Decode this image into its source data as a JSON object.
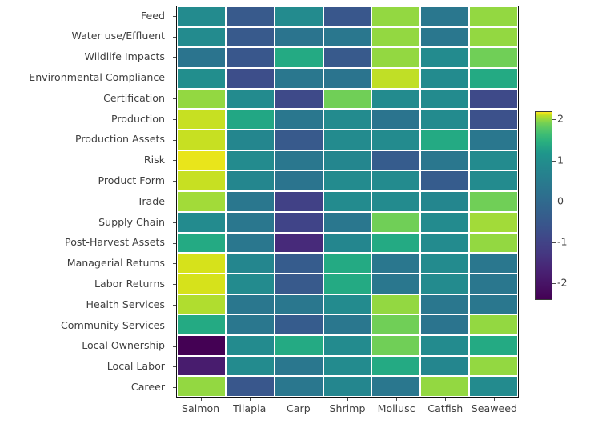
{
  "figure": {
    "type": "heatmap",
    "background": "#ffffff",
    "tick_label_color": "#3f3f3f"
  },
  "chart_data": {
    "type": "heatmap",
    "title": "",
    "xlabel": "",
    "ylabel": "",
    "colormap": "viridis",
    "grid": false,
    "legend_position": "right",
    "colorbar": {
      "vmin": -2.4,
      "vmax": 2.2,
      "ticks": [
        2,
        1,
        0,
        -1,
        -2
      ],
      "tick_labels": [
        "2",
        "1",
        "0",
        "-1",
        "-2"
      ]
    },
    "categories": [
      "Salmon",
      "Tilapia",
      "Carp",
      "Shrimp",
      "Mollusc",
      "Catfish",
      "Seaweed"
    ],
    "rows": [
      "Feed",
      "Water use/Effluent",
      "Wildlife Impacts",
      "Environmental Compliance",
      "Certification",
      "Production",
      "Production Assets",
      "Risk",
      "Product Form",
      "Trade",
      "Supply Chain",
      "Post-Harvest Assets",
      "Managerial Returns",
      "Labor Returns",
      "Health Services",
      "Community Services",
      "Local Ownership",
      "Local Labor",
      "Career"
    ],
    "row_labels_display": [
      "Feed",
      "Water use/Effluent",
      "Wildlife Impacts",
      "Environmental Compliance",
      "Certification",
      "Production",
      "Production Assets",
      "Risk",
      "Product Form",
      "Trade",
      "Supply Chain",
      "Post-Harvest Assets",
      "Managerial Returns",
      "Labor Returns",
      "Health Services",
      "Community Services",
      "Local Ownership",
      "Local Labor",
      "Career"
    ],
    "values": [
      [
        -0.15,
        -1.1,
        -0.15,
        -1.15,
        1.45,
        -0.55,
        1.45
      ],
      [
        -0.15,
        -1.1,
        -0.6,
        -0.55,
        1.45,
        -0.55,
        1.45
      ],
      [
        -0.6,
        -1.15,
        0.45,
        -1.1,
        1.45,
        -0.15,
        1.2
      ],
      [
        -0.1,
        -1.3,
        -0.55,
        -0.6,
        1.75,
        -0.15,
        0.45
      ],
      [
        1.45,
        -0.15,
        -1.35,
        1.2,
        -0.15,
        -0.15,
        -1.35
      ],
      [
        1.8,
        0.4,
        -0.55,
        -0.15,
        -0.6,
        -0.15,
        -1.25
      ],
      [
        1.8,
        -0.25,
        -1.1,
        -0.15,
        -0.15,
        0.45,
        -0.55
      ],
      [
        2.05,
        -0.15,
        -0.55,
        -0.25,
        -1.05,
        -0.55,
        -0.15
      ],
      [
        1.8,
        -0.25,
        -0.6,
        -0.15,
        -0.15,
        -1.05,
        -0.15
      ],
      [
        1.55,
        -0.55,
        -1.5,
        -0.15,
        -0.15,
        -0.25,
        1.2
      ],
      [
        -0.15,
        -0.55,
        -1.45,
        -0.55,
        1.2,
        -0.15,
        1.55
      ],
      [
        0.45,
        -0.55,
        -1.85,
        -0.25,
        0.45,
        -0.15,
        1.45
      ],
      [
        1.9,
        -0.25,
        -1.05,
        0.45,
        -0.55,
        -0.15,
        -0.55
      ],
      [
        1.9,
        -0.15,
        -1.1,
        0.45,
        -0.55,
        -0.15,
        -0.55
      ],
      [
        1.65,
        -0.55,
        -0.55,
        -0.15,
        1.45,
        -0.55,
        -0.55
      ],
      [
        0.45,
        -0.55,
        -1.05,
        -0.55,
        1.2,
        -0.6,
        1.45
      ],
      [
        -2.4,
        -0.15,
        0.45,
        -0.15,
        1.2,
        -0.15,
        0.45
      ],
      [
        -2.05,
        -0.15,
        -0.55,
        -0.15,
        0.45,
        -0.25,
        1.45
      ],
      [
        1.45,
        -1.15,
        -0.55,
        -0.25,
        -0.55,
        1.45,
        -0.15
      ]
    ]
  }
}
